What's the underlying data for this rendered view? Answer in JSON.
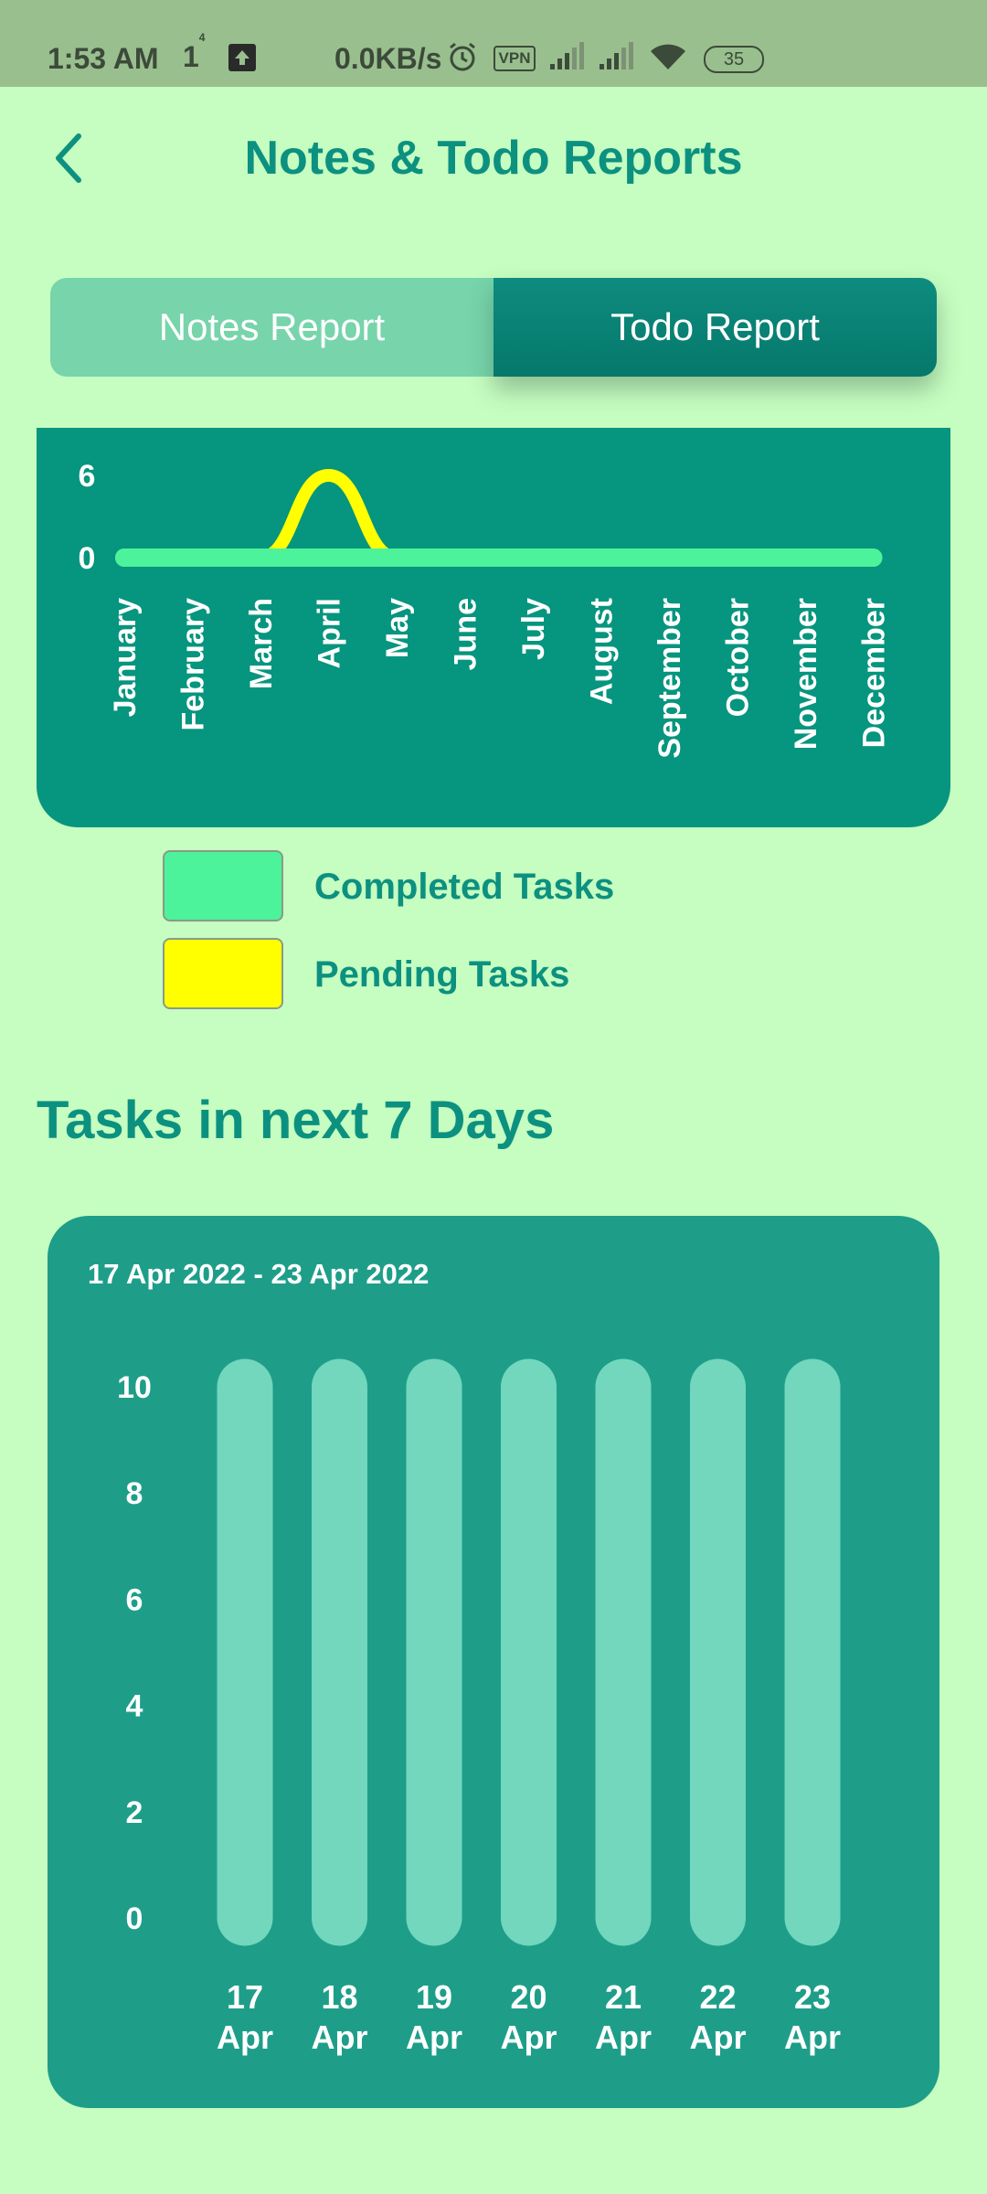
{
  "status_bar": {
    "time": "1:53 AM",
    "sim": "1",
    "sim_sup": "4",
    "speed": "0.0KB/s",
    "vpn": "VPN",
    "battery": "35",
    "icons": [
      "upload-icon",
      "alarm-icon",
      "vpn-icon",
      "signal-icon",
      "signal-icon",
      "wifi-icon",
      "battery-icon"
    ]
  },
  "header": {
    "title": "Notes & Todo Reports",
    "back_icon": "chevron-left-icon"
  },
  "tabs": [
    {
      "label": "Notes Report",
      "selected": false
    },
    {
      "label": "Todo Report",
      "selected": true
    }
  ],
  "legend": [
    {
      "label": "Completed Tasks",
      "color": "#4cf39a"
    },
    {
      "label": "Pending Tasks",
      "color": "#ffff00"
    }
  ],
  "section_title": "Tasks in next 7 Days",
  "chart_data": [
    {
      "type": "line",
      "categories": [
        "January",
        "February",
        "March",
        "April",
        "May",
        "June",
        "July",
        "August",
        "September",
        "October",
        "November",
        "December"
      ],
      "series": [
        {
          "name": "Completed Tasks",
          "color": "#4cf39a",
          "values": [
            0,
            0,
            0,
            0,
            0,
            0,
            0,
            0,
            0,
            0,
            0,
            0
          ]
        },
        {
          "name": "Pending Tasks",
          "color": "#ffff00",
          "values": [
            0,
            0,
            0,
            6,
            0,
            0,
            0,
            0,
            0,
            0,
            0,
            0
          ]
        }
      ],
      "yticks": [
        0,
        6
      ],
      "ylim": [
        0,
        6
      ],
      "grid": false
    },
    {
      "type": "bar",
      "title": "17 Apr 2022 - 23 Apr 2022",
      "categories": [
        [
          "17",
          "Apr"
        ],
        [
          "18",
          "Apr"
        ],
        [
          "19",
          "Apr"
        ],
        [
          "20",
          "Apr"
        ],
        [
          "21",
          "Apr"
        ],
        [
          "22",
          "Apr"
        ],
        [
          "23",
          "Apr"
        ]
      ],
      "values": [
        0,
        0,
        0,
        0,
        0,
        0,
        0
      ],
      "background_max": 10,
      "yticks": [
        0,
        2,
        4,
        6,
        8,
        10
      ],
      "ylim": [
        0,
        10
      ],
      "bar_bg_color": "#72d7bd",
      "grid": false
    }
  ]
}
